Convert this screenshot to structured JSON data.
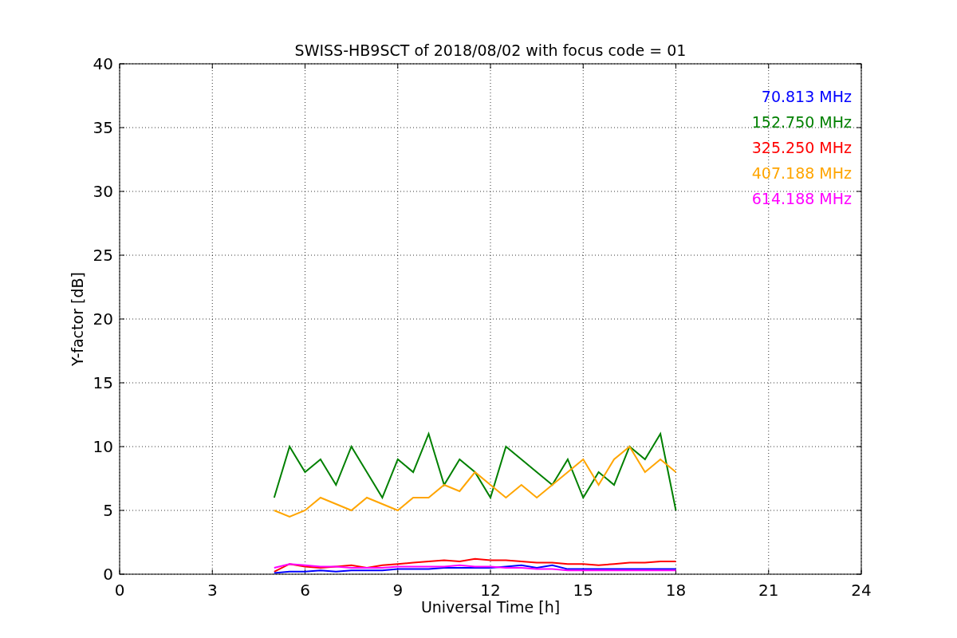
{
  "plot": {
    "chart_data": {
      "type": "line",
      "title": "SWISS-HB9SCT of 2018/08/02 with focus code = 01",
      "xlabel": "Universal Time [h]",
      "ylabel": "Y-factor [dB]",
      "x": [
        5,
        5.5,
        6,
        6.5,
        7,
        7.5,
        8,
        8.5,
        9,
        9.5,
        10,
        10.5,
        11,
        11.5,
        12,
        12.5,
        13,
        13.5,
        14,
        14.5,
        15,
        15.5,
        16,
        16.5,
        17,
        17.5,
        18
      ],
      "series": [
        {
          "name": "70.813 MHz",
          "color": "#0000ff",
          "values": [
            0.1,
            0.2,
            0.2,
            0.3,
            0.2,
            0.3,
            0.3,
            0.3,
            0.4,
            0.4,
            0.4,
            0.5,
            0.5,
            0.5,
            0.5,
            0.6,
            0.7,
            0.5,
            0.7,
            0.4,
            0.4,
            0.4,
            0.4,
            0.4,
            0.4,
            0.4,
            0.4
          ]
        },
        {
          "name": "152.750 MHz",
          "color": "#008000",
          "values": [
            6,
            10,
            8,
            9,
            7,
            10,
            8,
            6,
            9,
            8,
            11,
            7,
            9,
            8,
            6,
            10,
            9,
            8,
            7,
            9,
            6,
            8,
            7,
            10,
            9,
            11,
            5
          ]
        },
        {
          "name": "325.250 MHz",
          "color": "#ff0000",
          "values": [
            0.2,
            0.8,
            0.6,
            0.5,
            0.6,
            0.7,
            0.5,
            0.7,
            0.8,
            0.9,
            1,
            1.1,
            1,
            1.2,
            1.1,
            1.1,
            1,
            0.9,
            0.9,
            0.8,
            0.8,
            0.7,
            0.8,
            0.9,
            0.9,
            1,
            1
          ]
        },
        {
          "name": "407.188 MHz",
          "color": "#ffa500",
          "values": [
            5,
            4.5,
            5,
            6,
            5.5,
            5,
            6,
            5.5,
            5,
            6,
            6,
            7,
            6.5,
            8,
            7,
            6,
            7,
            6,
            7,
            8,
            9,
            7,
            9,
            10,
            8,
            9,
            8
          ]
        },
        {
          "name": "614.188 MHz",
          "color": "#ff00ff",
          "values": [
            0.5,
            0.8,
            0.7,
            0.6,
            0.6,
            0.5,
            0.5,
            0.5,
            0.6,
            0.6,
            0.6,
            0.6,
            0.7,
            0.6,
            0.6,
            0.5,
            0.5,
            0.4,
            0.4,
            0.3,
            0.3,
            0.3,
            0.3,
            0.3,
            0.3,
            0.3,
            0.3
          ]
        }
      ],
      "grid": true,
      "xlim": [
        0,
        24
      ],
      "ylim": [
        0,
        40
      ],
      "xticks": [
        0,
        3,
        6,
        9,
        12,
        15,
        18,
        21,
        24
      ],
      "yticks": [
        0,
        5,
        10,
        15,
        20,
        25,
        30,
        35,
        40
      ]
    }
  }
}
